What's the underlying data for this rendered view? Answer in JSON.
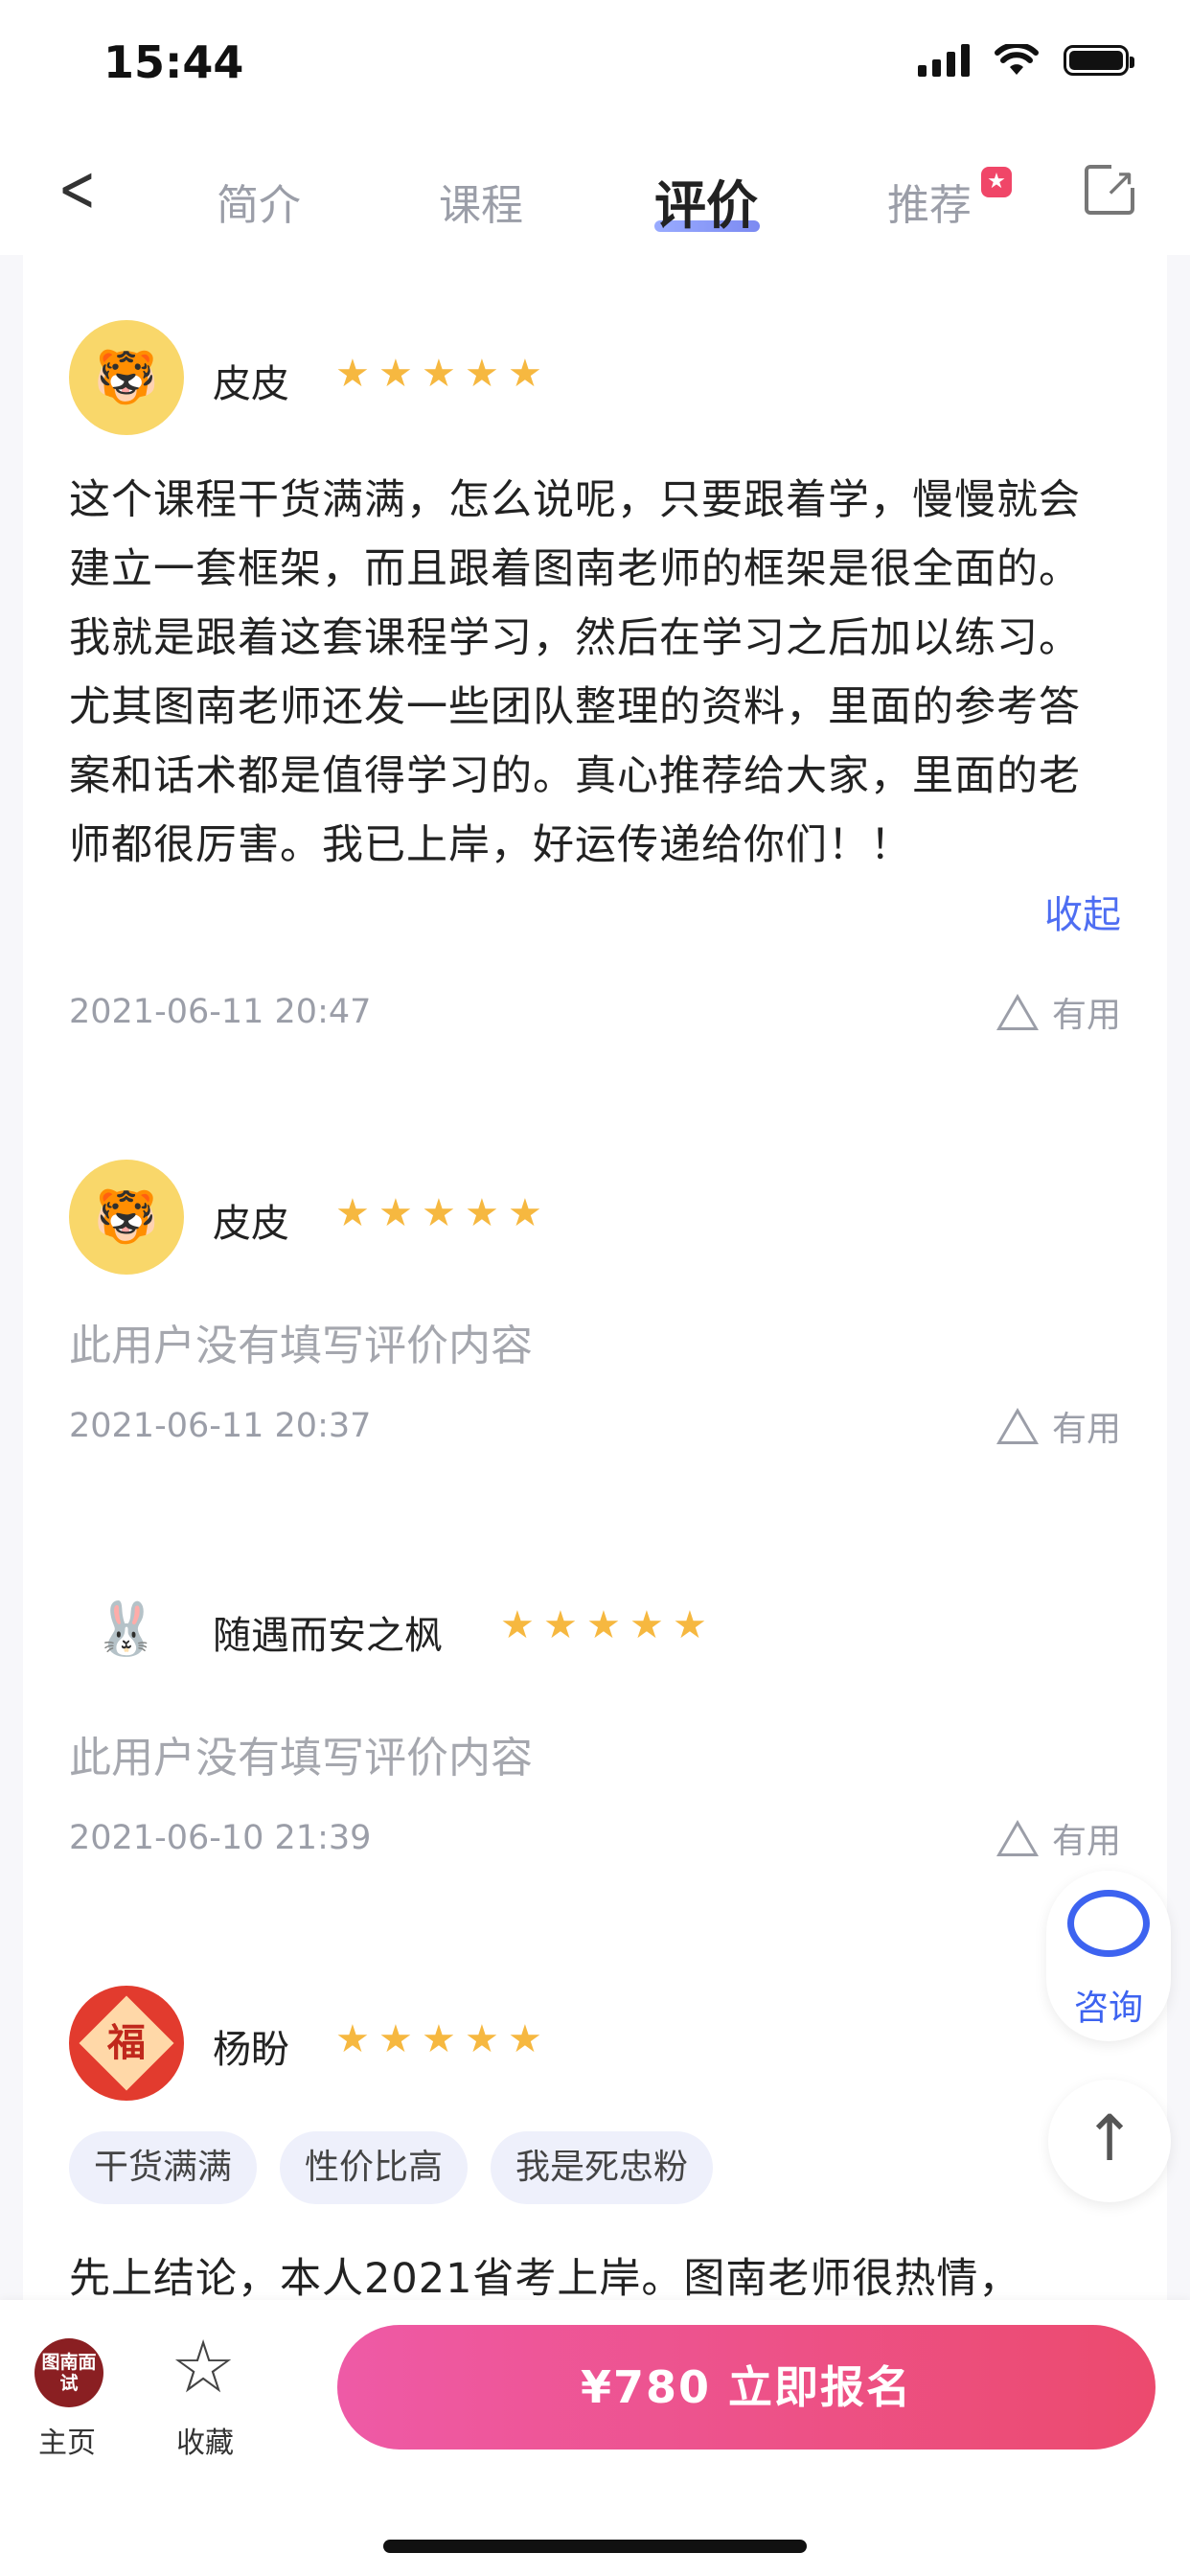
{
  "status_bar": {
    "time": "15:44"
  },
  "tabs": [
    {
      "label": "简介"
    },
    {
      "label": "课程"
    },
    {
      "label": "评价"
    },
    {
      "label": "推荐"
    }
  ],
  "reviews": [
    {
      "name": "皮皮",
      "text": "这个课程干货满满，怎么说呢，只要跟着学，慢慢就会建立一套框架，而且跟着图南老师的框架是很全面的。我就是跟着这套课程学习，然后在学习之后加以练习。尤其图南老师还发一些团队整理的资料，里面的参考答案和话术都是值得学习的。真心推荐给大家，里面的老师都很厉害。我已上岸，好运传递给你们！！",
      "collapse": "收起",
      "date": "2021-06-11 20:47",
      "useful": "有用"
    },
    {
      "name": "皮皮",
      "text": "此用户没有填写评价内容",
      "date": "2021-06-11 20:37",
      "useful": "有用"
    },
    {
      "name": "随遇而安之枫",
      "text": "此用户没有填写评价内容",
      "date": "2021-06-10 21:39",
      "useful": "有用"
    },
    {
      "name": "杨盼",
      "tags": [
        "干货满满",
        "性价比高",
        "我是死忠粉"
      ],
      "text": "先上结论，本人2021省考上岸。图南老师很热情，"
    }
  ],
  "rating": {
    "stars": 5,
    "max": 5
  },
  "avatar_fu_char": "福",
  "consult_label": "咨询",
  "bottom_bar": {
    "home_logo": "图南面试",
    "home_label": "主页",
    "fav_label": "收藏",
    "cta_label": "¥780  立即报名"
  },
  "colors": {
    "accent_blue": "#4e6ef2",
    "star": "#f6b840",
    "cta_start": "#ee5aa6",
    "cta_end": "#ec4a6e"
  }
}
